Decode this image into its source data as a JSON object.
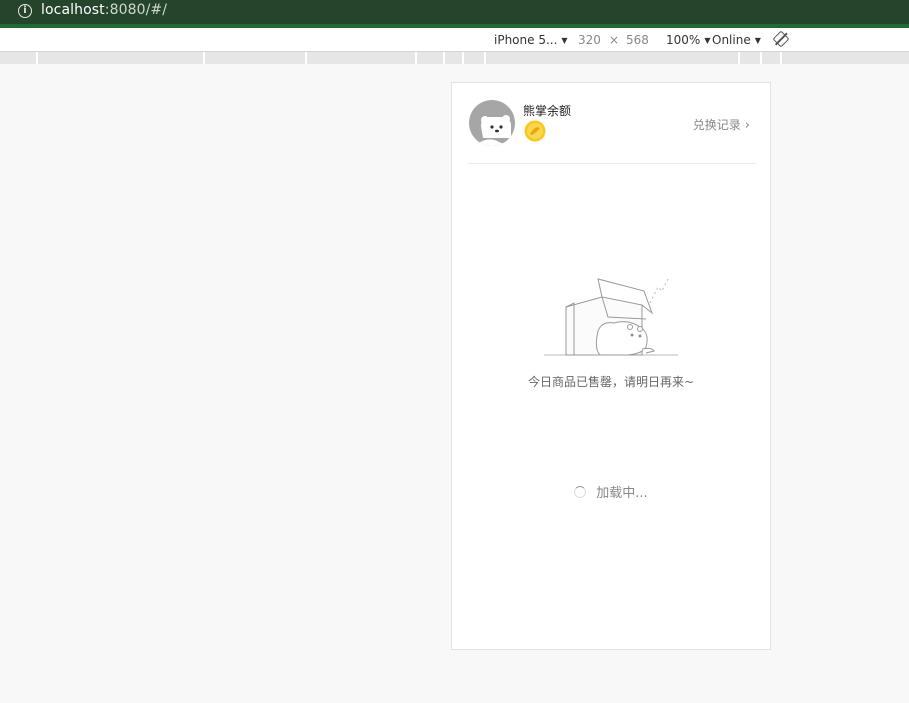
{
  "browser": {
    "url_host": "localhost",
    "url_rest": ":8080/#/"
  },
  "device_toolbar": {
    "device": "iPhone 5...",
    "width": "320",
    "times": "×",
    "height": "568",
    "zoom": "100%",
    "network": "Online",
    "dropdown_glyph": "▼"
  },
  "header": {
    "balance_label": "熊掌余额",
    "exchange_label": "兑换记录",
    "chevron": "›"
  },
  "empty_state": {
    "message": "今日商品已售罄，请明日再来~"
  },
  "loading": {
    "label": "加载中..."
  },
  "icons": {
    "address": "info-icon",
    "rotate": "rotate-icon",
    "coin": "bear-paw-coin-icon",
    "avatar": "bear-avatar-icon"
  },
  "colors": {
    "addrbar": "#24452b",
    "coin": "#f7c81e",
    "avatar_bg": "#a6a6a6"
  }
}
